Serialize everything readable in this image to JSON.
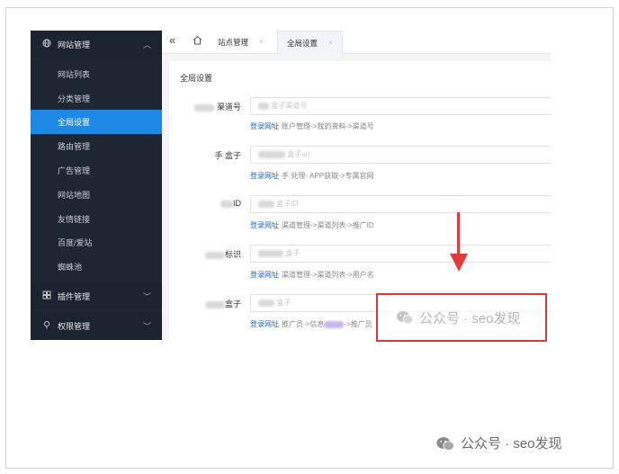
{
  "sidebar": {
    "site_group": {
      "label": "网站管理",
      "icon": "globe-icon"
    },
    "items": [
      {
        "label": "网站列表",
        "active": false
      },
      {
        "label": "分类管理",
        "active": false
      },
      {
        "label": "全局设置",
        "active": true
      },
      {
        "label": "路由管理",
        "active": false
      },
      {
        "label": "广告管理",
        "active": false
      },
      {
        "label": "网站地图",
        "active": false
      },
      {
        "label": "友情链接",
        "active": false
      },
      {
        "label": "百度/爱站",
        "active": false
      },
      {
        "label": "蜘蛛池",
        "active": false
      }
    ],
    "plugin_group": {
      "label": "插件管理",
      "icon": "puzzle-icon"
    },
    "perm_group": {
      "label": "权限管理",
      "icon": "pin-icon"
    }
  },
  "tabs": [
    {
      "label": "站点管理"
    },
    {
      "label": "全局设置",
      "active": true
    }
  ],
  "page": {
    "title": "全局设置",
    "fields": [
      {
        "label": "渠道号",
        "placeholder": "盒子渠道号",
        "link": "登录网址",
        "hint": "账户管理->我的资料->渠道号"
      },
      {
        "label": "手 盒子",
        "placeholder": "盒子url",
        "link": "登录网址",
        "hint": "手 处理- APP获取->专属官网"
      },
      {
        "label": "ID",
        "placeholder": "盒子ID",
        "link": "登录网址",
        "hint": "渠道管理->渠道列表->推广ID"
      },
      {
        "label": "标识",
        "placeholder": "盒子",
        "link": "登录网址",
        "hint": "渠道管理->渠道列表->用户名"
      },
      {
        "label": "盒子",
        "placeholder": "盒子",
        "link": "登录网址",
        "hint_pre": "推广员->信息",
        "hint_post": "->推广员"
      }
    ]
  },
  "watermark": {
    "text": "公众号 · seo发现"
  },
  "footer": {
    "text": "公众号 · seo发现"
  },
  "colors": {
    "sidebar_bg": "#1f2633",
    "accent": "#1e88e5",
    "link": "#1e66c8",
    "highlight": "#d63a3a"
  }
}
